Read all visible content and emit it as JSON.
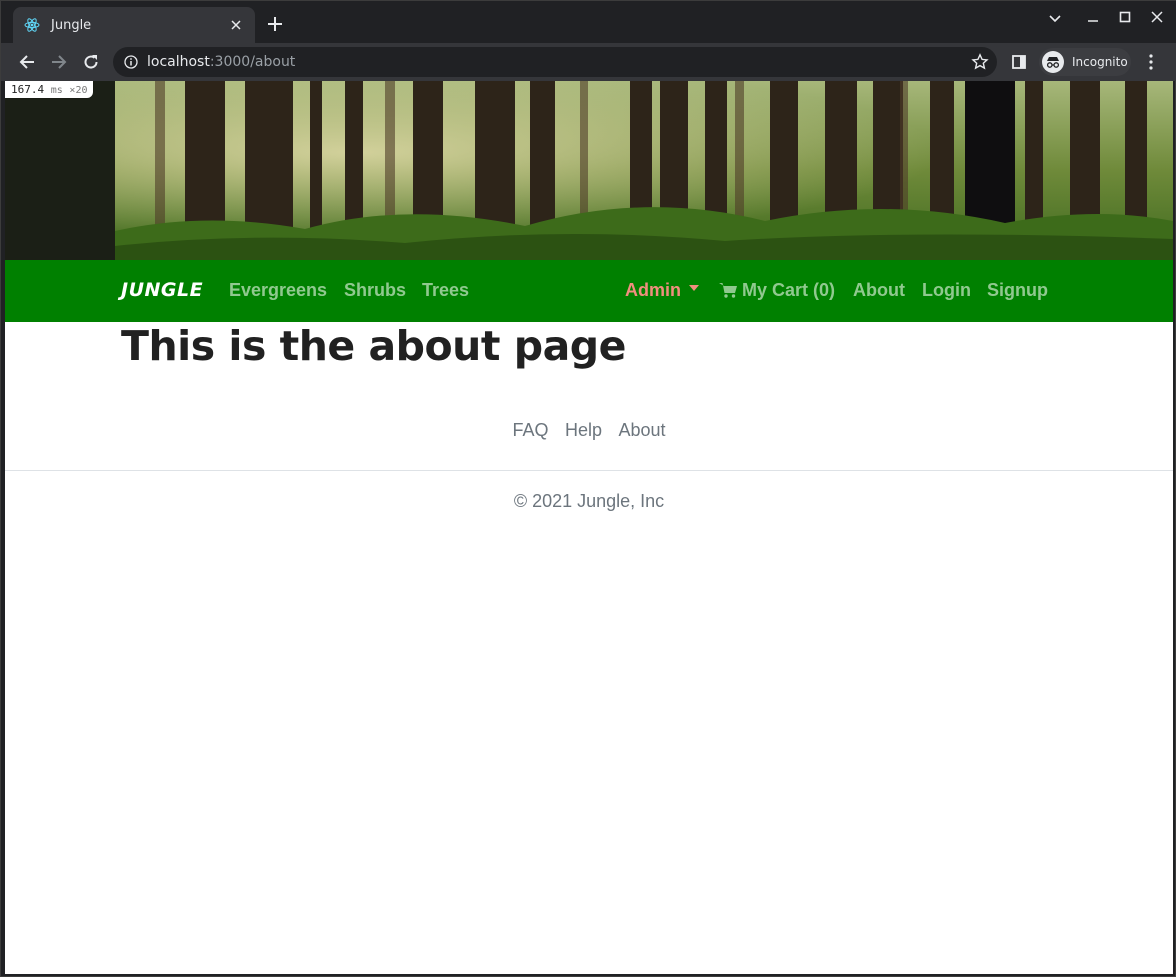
{
  "browser": {
    "tab_title": "Jungle",
    "url_host": "localhost",
    "url_path": ":3000/about",
    "profile_label": "Incognito"
  },
  "perf": {
    "value": "167.4",
    "unit": "ms",
    "multiplier": "×20"
  },
  "navbar": {
    "brand": "JUNGLE",
    "links": [
      "Evergreens",
      "Shrubs",
      "Trees"
    ],
    "admin": "Admin",
    "cart": "My Cart (0)",
    "about": "About",
    "login": "Login",
    "signup": "Signup"
  },
  "main": {
    "title": "This is the about page"
  },
  "footer": {
    "links": [
      "FAQ",
      "Help",
      "About"
    ],
    "copyright": "© 2021 Jungle, Inc"
  },
  "colors": {
    "navbar_bg": "#008000",
    "nav_link": "#90c98f",
    "admin_link": "#f08f7e"
  }
}
